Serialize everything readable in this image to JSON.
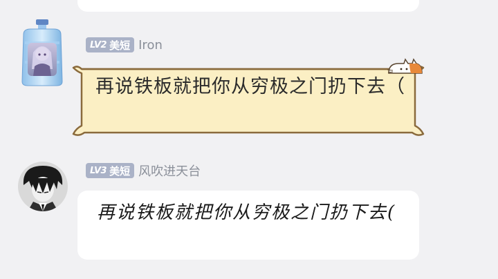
{
  "messages": [
    {
      "level": "LV2",
      "badge_label": "美短",
      "username": "Iron",
      "text": "再说铁板就把你从穷极之门扔下去（",
      "avatar": "water-jug-avatar",
      "bubble_style": "scroll-cat"
    },
    {
      "level": "LV3",
      "badge_label": "美短",
      "username": "风吹进天台",
      "text": "再说铁板就把你从穷极之门扔下去(",
      "avatar": "anime-boy-avatar",
      "bubble_style": "handwritten-white"
    }
  ],
  "colors": {
    "background": "#f1f1f3",
    "badge": "#aab2c7",
    "scroll_fill": "#fbefc4",
    "scroll_border": "#8a6a3c",
    "username": "#8a8f99"
  }
}
